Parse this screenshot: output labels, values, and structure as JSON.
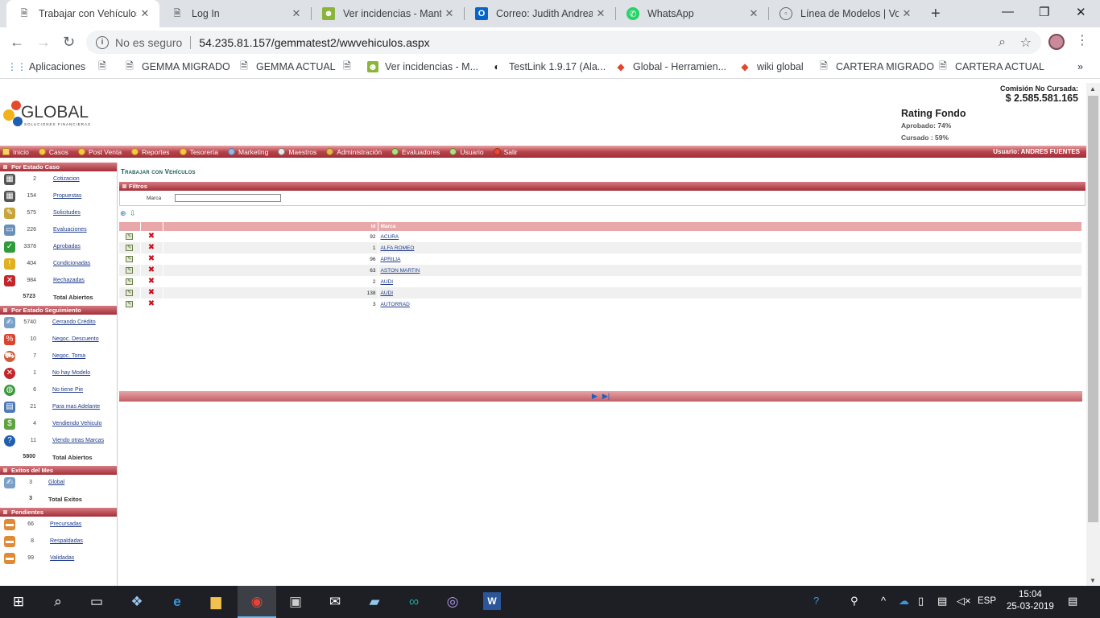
{
  "browser": {
    "tabs": [
      {
        "label": "Trabajar con Vehículos",
        "icon": "document-icon",
        "active": true
      },
      {
        "label": "Log In",
        "icon": "document-icon",
        "active": false
      },
      {
        "label": "Ver incidencias - Mantis",
        "icon": "mantis-icon",
        "active": false
      },
      {
        "label": "Correo: Judith Andrea C",
        "icon": "outlook-icon",
        "active": false
      },
      {
        "label": "WhatsApp",
        "icon": "whatsapp-icon",
        "active": false
      },
      {
        "label": "Línea de Modelos | Volvo",
        "icon": "volvo-icon",
        "active": false
      }
    ],
    "security_label": "No es seguro",
    "url": "54.235.81.157/gemmatest2/wwvehiculos.aspx",
    "bookmarks": [
      {
        "label": "Aplicaciones",
        "icon": "apps-grid-icon"
      },
      {
        "label": "",
        "icon": "document-icon"
      },
      {
        "label": "GEMMA MIGRADO",
        "icon": "document-icon"
      },
      {
        "label": "GEMMA ACTUAL",
        "icon": "document-icon"
      },
      {
        "label": "",
        "icon": "document-icon"
      },
      {
        "label": "Ver incidencias - M...",
        "icon": "mantis-icon"
      },
      {
        "label": "TestLink 1.9.17 (Ala...",
        "icon": "testlink-icon"
      },
      {
        "label": "Global - Herramien...",
        "icon": "global-icon"
      },
      {
        "label": "wiki global",
        "icon": "global-icon"
      },
      {
        "label": "CARTERA MIGRADO",
        "icon": "document-icon"
      },
      {
        "label": "CARTERA ACTUAL",
        "icon": "document-icon"
      }
    ]
  },
  "header": {
    "logo_main": "GLOBAL",
    "logo_sub": "SOLUCIONES FINANCIERAS",
    "commission_label": "Comisión No Cursada:",
    "commission_amount": "$ 2.585.581.165",
    "rating_title": "Rating Fondo",
    "rating_aprobado": "Aprobado: 74%",
    "rating_cursado": "Cursado : 59%"
  },
  "menu": {
    "items": [
      "Inicio",
      "Casos",
      "Post Venta",
      "Reportes",
      "Tesorería",
      "Marketing",
      "Maestros",
      "Administración",
      "Evaluadores",
      "Usuario",
      "Salir"
    ],
    "user": "Usuario:  ANDRES FUENTES"
  },
  "sidebar": {
    "sections": [
      {
        "title": "Por Estado Caso",
        "rows": [
          {
            "count": "2",
            "label": "Cotizacion",
            "icon": "calculator-icon",
            "color": "#555"
          },
          {
            "count": "154",
            "label": "Propuestas",
            "icon": "calculator-icon",
            "color": "#555"
          },
          {
            "count": "575",
            "label": "Solicitudes",
            "icon": "form-icon",
            "color": "#c7a53a"
          },
          {
            "count": "226",
            "label": "Evaluaciones",
            "icon": "monitor-icon",
            "color": "#6a8fb8"
          },
          {
            "count": "3378",
            "label": "Aprobadas",
            "icon": "shield-check-icon",
            "color": "#2f9b3a"
          },
          {
            "count": "404",
            "label": "Condicionadas",
            "icon": "shield-warning-icon",
            "color": "#e0b020"
          },
          {
            "count": "984",
            "label": "Rechazadas",
            "icon": "shield-x-icon",
            "color": "#c3252b"
          }
        ],
        "total_count": "5723",
        "total_label": "Total Abiertos"
      },
      {
        "title": "Por Estado Seguimiento",
        "rows": [
          {
            "count": "5740",
            "label": "Cerrando Crédito",
            "icon": "pen-icon",
            "color": "#7aa0c8"
          },
          {
            "count": "10",
            "label": "Negoc. Descuento",
            "icon": "tag-icon",
            "color": "#d9452e"
          },
          {
            "count": "7",
            "label": "Negoc. Toma",
            "icon": "car-icon",
            "color": "#cf5d35"
          },
          {
            "count": "1",
            "label": "No hay Modelo",
            "icon": "x-circle-icon",
            "color": "#c3252b"
          },
          {
            "count": "6",
            "label": "No tiene Pie",
            "icon": "globe-icon",
            "color": "#3c9a3c"
          },
          {
            "count": "21",
            "label": "Para mas Adelante",
            "icon": "calendar-icon",
            "color": "#4a78b8"
          },
          {
            "count": "4",
            "label": "Vendiendo Vehiculo",
            "icon": "money-icon",
            "color": "#5ea340"
          },
          {
            "count": "11",
            "label": "Viendo otras Marcas",
            "icon": "question-icon",
            "color": "#1f5fb0"
          }
        ],
        "total_count": "5800",
        "total_label": "Total Abiertos"
      },
      {
        "title": "Exitos del Mes",
        "rows": [
          {
            "count": "3",
            "label": "Global",
            "icon": "pen-icon",
            "color": "#7aa0c8"
          }
        ],
        "total_count": "3",
        "total_label": "Total Exitos"
      },
      {
        "title": "Pendientes",
        "rows": [
          {
            "count": "66",
            "label": "Precursadas",
            "icon": "folder-icon",
            "color": "#e08a35"
          },
          {
            "count": "8",
            "label": "Respaldadas",
            "icon": "folder-icon",
            "color": "#e08a35"
          },
          {
            "count": "99",
            "label": "Validadas",
            "icon": "folder-icon",
            "color": "#e08a35"
          }
        ],
        "total_count": "",
        "total_label": ""
      }
    ]
  },
  "main": {
    "title": "Trabajar con Vehículos",
    "filters_title": "Filtros",
    "filter_label": "Marca",
    "filter_value": "",
    "grid": {
      "headers": [
        "",
        "",
        "Id",
        "Marca"
      ],
      "rows": [
        {
          "id": "92",
          "marca": "ACURA"
        },
        {
          "id": "1",
          "marca": "ALFA ROMEO"
        },
        {
          "id": "96",
          "marca": "APRILIA"
        },
        {
          "id": "63",
          "marca": "ASTON MARTIN"
        },
        {
          "id": "2",
          "marca": "AUDI"
        },
        {
          "id": "138",
          "marca": "AUDI"
        },
        {
          "id": "3",
          "marca": "AUTORRAD"
        }
      ]
    }
  },
  "taskbar": {
    "language": "ESP",
    "time": "15:04",
    "date": "25-03-2019"
  }
}
